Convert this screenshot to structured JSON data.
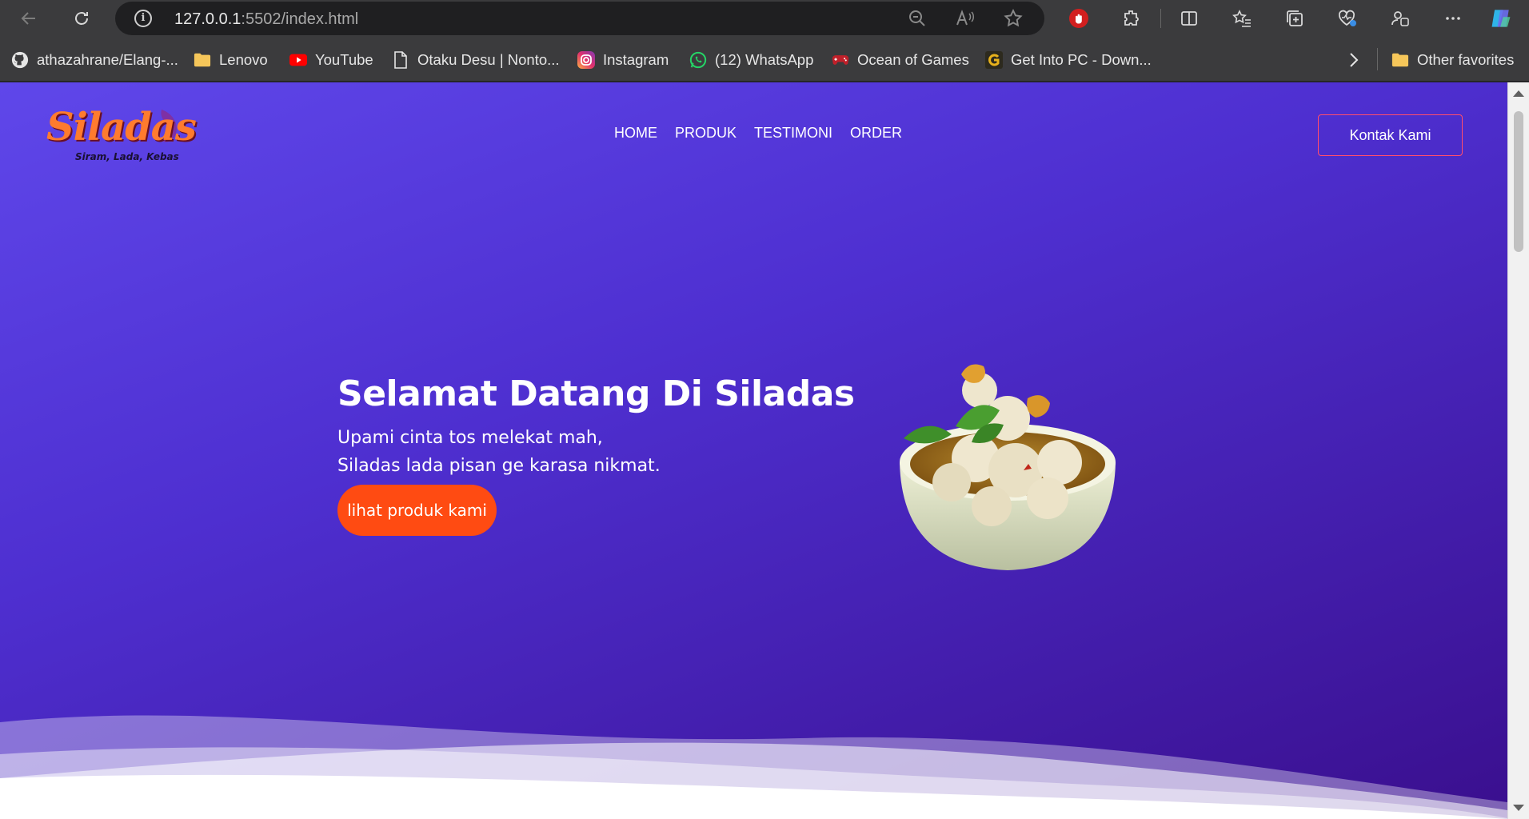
{
  "browser": {
    "url_host": "127.0.0.1",
    "url_rest": ":5502/index.html",
    "bookmarks": [
      {
        "label": "athazahrane/Elang-...",
        "icon": "github-icon"
      },
      {
        "label": "Lenovo",
        "icon": "folder-icon"
      },
      {
        "label": "YouTube",
        "icon": "youtube-icon"
      },
      {
        "label": "Otaku Desu | Nonto...",
        "icon": "page-icon"
      },
      {
        "label": "Instagram",
        "icon": "instagram-icon"
      },
      {
        "label": "(12) WhatsApp",
        "icon": "whatsapp-icon"
      },
      {
        "label": "Ocean of Games",
        "icon": "gamepad-icon"
      },
      {
        "label": "Get Into PC - Down...",
        "icon": "getintopc-icon"
      }
    ],
    "other_favorites": "Other favorites"
  },
  "site": {
    "logo_title": "Siladas",
    "logo_tagline": "Siram, Lada, Kebas",
    "menu": [
      "HOME",
      "PRODUK",
      "TESTIMONI",
      "ORDER"
    ],
    "contact_button": "Kontak Kami",
    "hero": {
      "title": "Selamat Datang Di Siladas",
      "line1": "Upami cinta tos melekat mah,",
      "line2": "Siladas lada pisan ge karasa nikmat.",
      "cta": "lihat produk kami"
    }
  },
  "colors": {
    "hero_gradient_start": "#5f47ea",
    "hero_gradient_end": "#3a0f8e",
    "cta": "#ff4b12",
    "contact_border": "#ff4d6d"
  }
}
